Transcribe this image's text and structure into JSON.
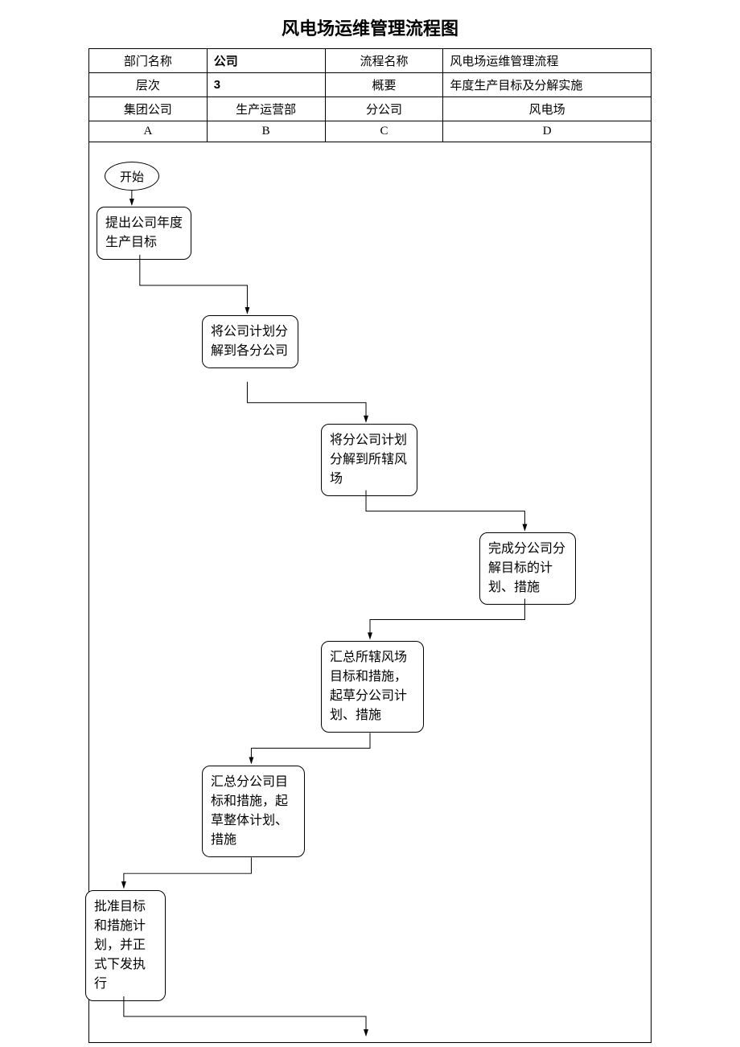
{
  "title": "风电场运维管理流程图",
  "header": {
    "deptLabel": "部门名称",
    "deptValue": "公司",
    "procLabel": "流程名称",
    "procValue": "风电场运维管理流程",
    "levelLabel": "层次",
    "levelValue": "3",
    "summaryLabel": "概要",
    "summaryValue": "年度生产目标及分解实施",
    "colA": "集团公司",
    "colB": "生产运营部",
    "colC": "分公司",
    "colD": "风电场",
    "letterA": "A",
    "letterB": "B",
    "letterC": "C",
    "letterD": "D"
  },
  "nodes": {
    "start": "开始",
    "n1": "提出公司年度生产目标",
    "n2": "将公司计划分解到各分公司",
    "n3": "将分公司计划分解到所辖风场",
    "n4": "完成分公司分解目标的计划、措施",
    "n5": "汇总所辖风场目标和措施，起草分公司计划、措施",
    "n6": "汇总分公司目标和措施，起草整体计划、措施",
    "n7": "批准目标和措施计划，并正式下发执行"
  }
}
